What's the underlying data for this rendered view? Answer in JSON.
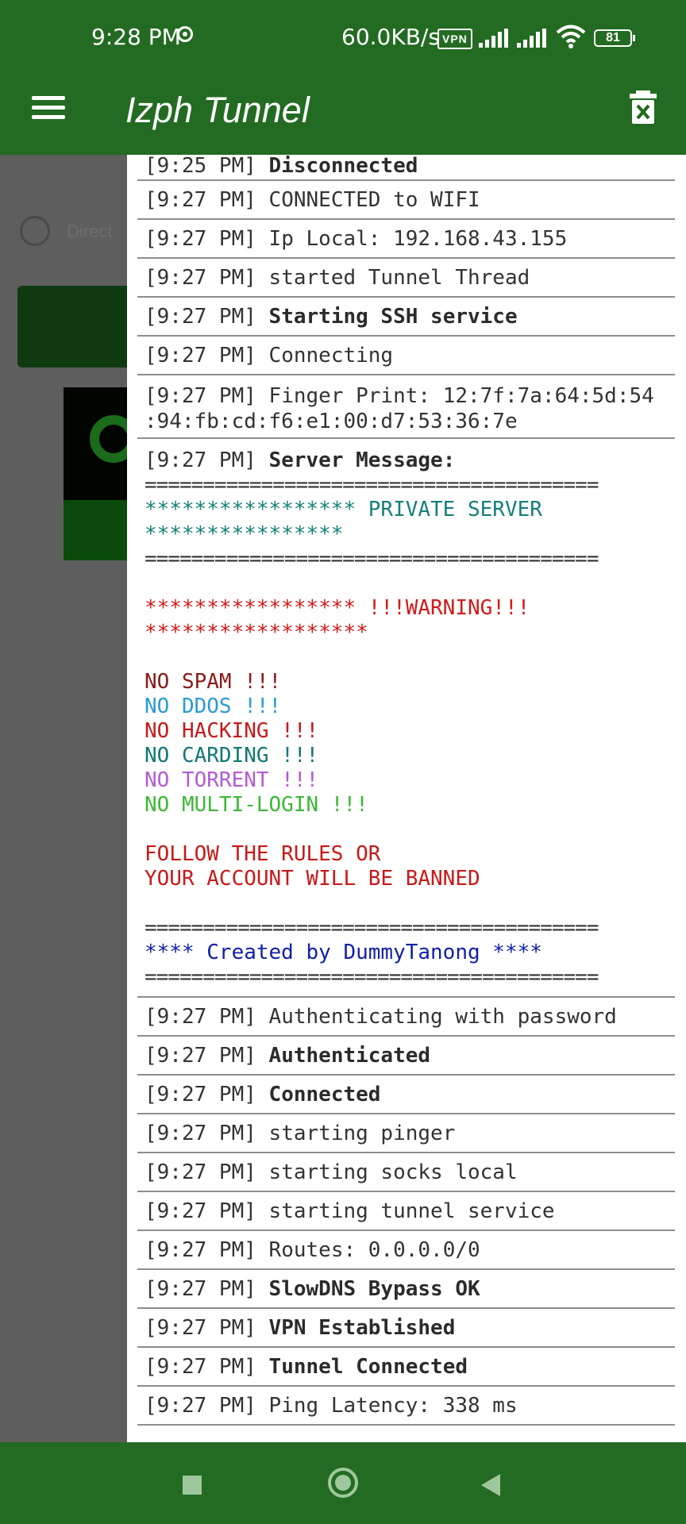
{
  "status_bar": {
    "time": "9:28 PM",
    "speed": "60.0KB/s",
    "vpn_label": "VPN",
    "battery": "81"
  },
  "app_bar": {
    "title": "Izph Tunnel",
    "menu_icon": "hamburger-menu-icon",
    "clear_icon": "trash-clear-icon"
  },
  "background": {
    "radio_label": "Direct"
  },
  "log": {
    "lines": [
      {
        "ts": "[9:25 PM]",
        "msg": "Disconnected",
        "bold": true
      },
      {
        "ts": "[9:27 PM]",
        "msg": "CONNECTED to WIFI",
        "bold": false
      },
      {
        "ts": "[9:27 PM]",
        "msg": "Ip Local: 192.168.43.155",
        "bold": false
      },
      {
        "ts": "[9:27 PM]",
        "msg": "started Tunnel Thread",
        "bold": false
      },
      {
        "ts": "[9:27 PM]",
        "msg": "Starting SSH service",
        "bold": true
      },
      {
        "ts": "[9:27 PM]",
        "msg": "Connecting",
        "bold": false
      },
      {
        "ts": "[9:27 PM]",
        "msg": "Finger Print: 12:7f:7a:64:5d:54",
        "msg2": ":94:fb:cd:f6:e1:00:d7:53:36:7e",
        "bold": false
      },
      {
        "ts": "[9:27 PM]",
        "msg": "Server Message:",
        "bold": true
      }
    ],
    "server_message": {
      "separator": "=======================================",
      "private_line1": "***************** PRIVATE SERVER",
      "private_line2": "****************",
      "warning_line1": "***************** !!!WARNING!!!",
      "warning_line2": "******************",
      "rules": [
        "NO SPAM !!!",
        "NO DDOS !!!",
        "NO HACKING !!!",
        "NO CARDING !!!",
        "NO TORRENT !!!",
        "NO MULTI-LOGIN !!!"
      ],
      "follow_line1": "FOLLOW THE RULES OR",
      "follow_line2": "YOUR ACCOUNT WILL BE BANNED",
      "created_by": "**** Created by DummyTanong ****"
    },
    "lines_after": [
      {
        "ts": "[9:27 PM]",
        "msg": "Authenticating with password",
        "bold": false
      },
      {
        "ts": "[9:27 PM]",
        "msg": "Authenticated",
        "bold": true
      },
      {
        "ts": "[9:27 PM]",
        "msg": "Connected",
        "bold": true
      },
      {
        "ts": "[9:27 PM]",
        "msg": "starting pinger",
        "bold": false
      },
      {
        "ts": "[9:27 PM]",
        "msg": "starting socks local",
        "bold": false
      },
      {
        "ts": "[9:27 PM]",
        "msg": "starting tunnel service",
        "bold": false
      },
      {
        "ts": "[9:27 PM]",
        "msg": "Routes: 0.0.0.0/0",
        "bold": false
      },
      {
        "ts": "[9:27 PM]",
        "msg": "SlowDNS Bypass OK",
        "bold": true
      },
      {
        "ts": "[9:27 PM]",
        "msg": "VPN Established",
        "bold": true
      },
      {
        "ts": "[9:27 PM]",
        "msg": "Tunnel Connected",
        "bold": true
      },
      {
        "ts": "[9:27 PM]",
        "msg": "Ping Latency: 338 ms",
        "bold": false
      }
    ]
  },
  "nav_bar": {
    "recents_icon": "square-recents-icon",
    "home_icon": "circle-home-icon",
    "back_icon": "triangle-back-icon"
  },
  "colors": {
    "primary": "#236b22",
    "teal": "#167f7a",
    "red": "#d11a1a",
    "navy": "#1120a8",
    "purple": "#b45bd4",
    "green": "#3cb835"
  }
}
